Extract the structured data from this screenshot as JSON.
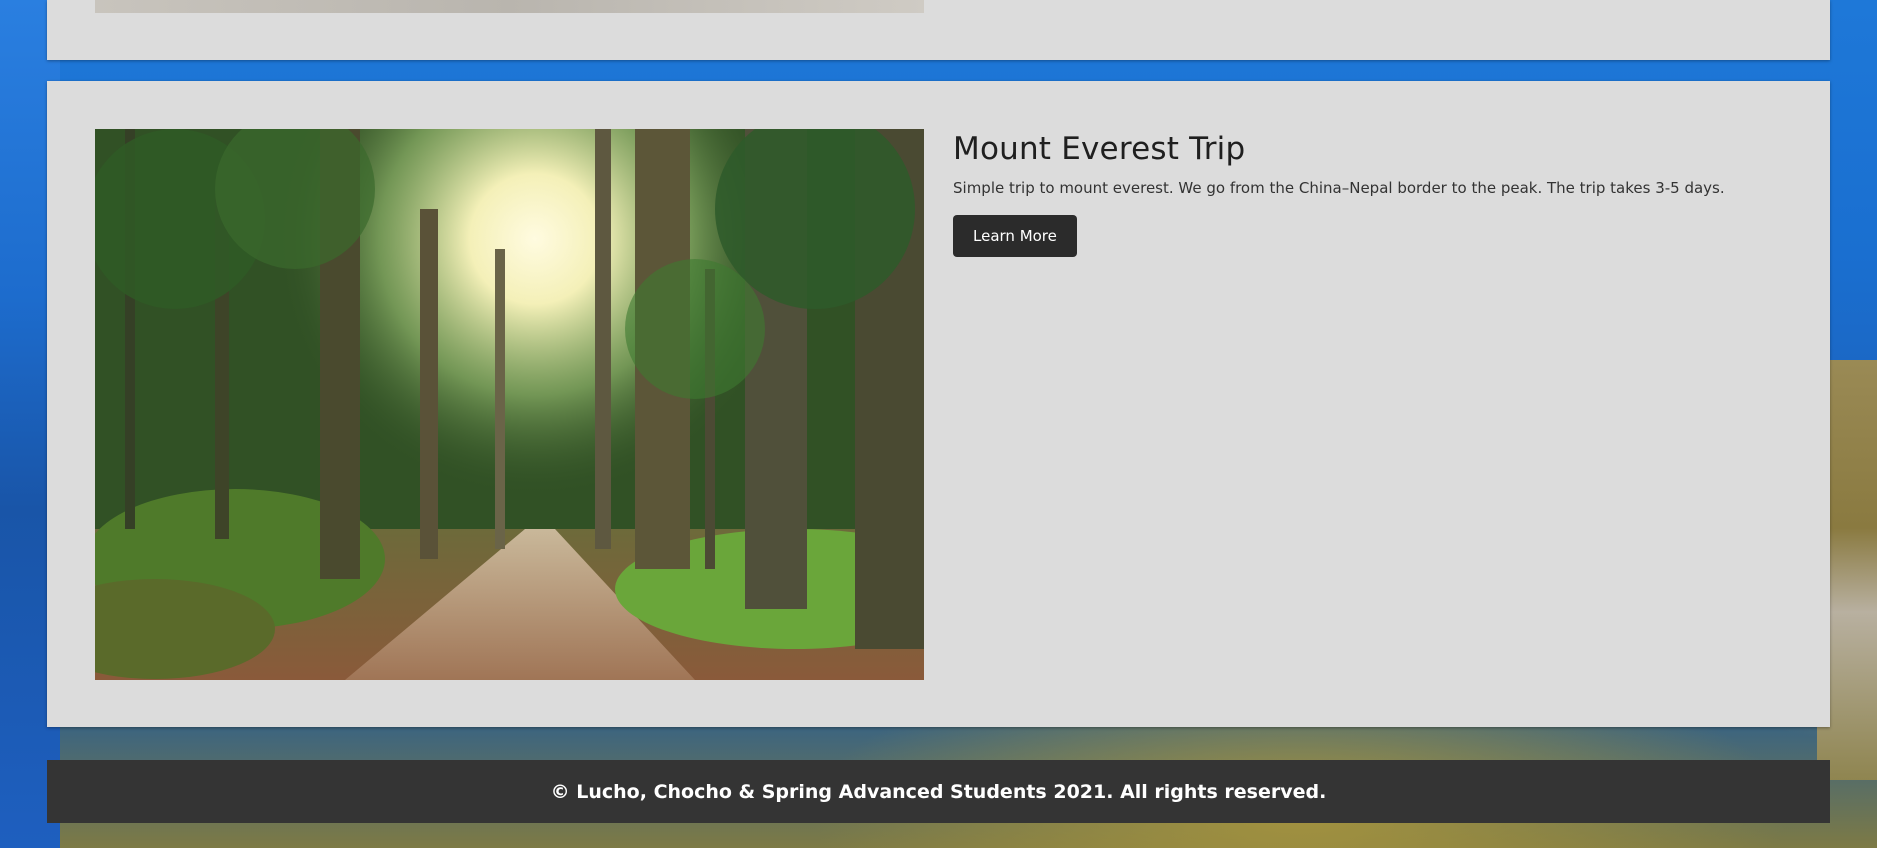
{
  "trip": {
    "title": "Mount Everest Trip",
    "description": "Simple trip to mount everest. We go from the China–Nepal border to the peak. The trip takes 3-5 days.",
    "button_label": "Learn More",
    "image_icon": "forest-photo"
  },
  "footer": {
    "text": "© Lucho, Chocho & Spring Advanced Students 2021. All rights reserved."
  },
  "colors": {
    "card_background": "#dcdcdc",
    "button_background": "#2b2b2b",
    "footer_background": "#343434",
    "page_background": "#1e6fd0"
  }
}
